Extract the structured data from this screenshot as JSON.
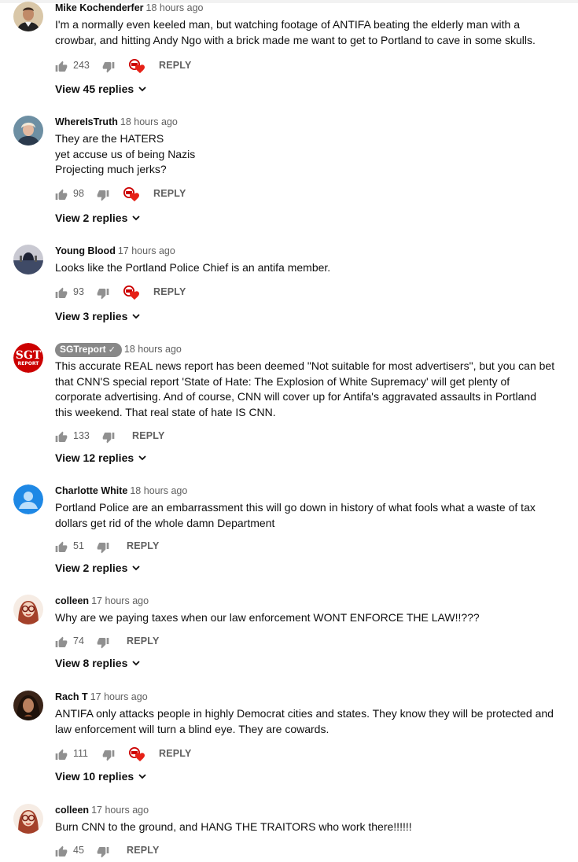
{
  "comments": [
    {
      "author": "Mike Kochenderfer",
      "time": "18 hours ago",
      "lines": [
        "I'm a normally even keeled man, but watching footage of ANTIFA beating the elderly man with a",
        "crowbar, and hitting Andy Ngo with a brick made me want to get to Portland to cave in some skulls."
      ],
      "likes": "243",
      "reply": "REPLY",
      "creator_heart": true,
      "view_replies": "View 45 replies"
    },
    {
      "author": "WhereIsTruth",
      "time": "18 hours ago",
      "lines": [
        "They are the HATERS",
        "yet accuse us of being Nazis",
        "Projecting much jerks?"
      ],
      "likes": "98",
      "reply": "REPLY",
      "creator_heart": true,
      "view_replies": "View 2 replies"
    },
    {
      "author": "Young Blood",
      "time": "17 hours ago",
      "lines": [
        "Looks like the Portland Police Chief is an antifa member."
      ],
      "likes": "93",
      "reply": "REPLY",
      "creator_heart": true,
      "view_replies": "View 3 replies"
    },
    {
      "author": "SGTreport",
      "verified": true,
      "time": "18 hours ago",
      "lines": [
        "This accurate REAL news report has been deemed \"Not suitable for most advertisers\", but you can bet",
        "that CNN'S special report 'State of Hate: The Explosion of White Supremacy' will get plenty of",
        "corporate advertising.  And of course, CNN will cover up for Antifa's aggravated assaults in Portland",
        "this weekend. That real state of hate IS CNN."
      ],
      "likes": "133",
      "reply": "REPLY",
      "creator_heart": false,
      "view_replies": "View 12 replies"
    },
    {
      "author": "Charlotte White",
      "time": "18 hours ago",
      "lines": [
        "Portland Police are an embarrassment this will go down in history of what fools what a waste of tax",
        "dollars get rid of the whole damn Department"
      ],
      "likes": "51",
      "reply": "REPLY",
      "creator_heart": false,
      "view_replies": "View 2 replies"
    },
    {
      "author": "colleen",
      "time": "17 hours ago",
      "lines": [
        "Why are we paying taxes when our law enforcement WONT ENFORCE THE LAW!!???"
      ],
      "likes": "74",
      "reply": "REPLY",
      "creator_heart": false,
      "view_replies": "View 8 replies"
    },
    {
      "author": "Rach T",
      "time": "17 hours ago",
      "lines": [
        "ANTIFA only attacks people in highly Democrat cities and states. They know they will be protected and",
        "law enforcement will turn a blind eye. They are cowards."
      ],
      "likes": "111",
      "reply": "REPLY",
      "creator_heart": true,
      "view_replies": "View 10 replies"
    },
    {
      "author": "colleen",
      "time": "17 hours ago",
      "lines": [
        "Burn CNN to the ground, and HANG THE TRAITORS who work there!!!!!!"
      ],
      "likes": "45",
      "reply": "REPLY",
      "creator_heart": false,
      "view_replies": ""
    }
  ],
  "channel_logo": {
    "line1": "SGT",
    "line2": "REPORT"
  },
  "colors": {
    "text": "#0f0f0f",
    "secondary": "#606060",
    "badge_bg": "#888888",
    "heart": "#e62117",
    "sgt_red": "#cc0000"
  },
  "icons": [
    "thumbs-up-icon",
    "thumbs-down-icon",
    "creator-heart-icon",
    "chevron-down-icon",
    "verified-check-icon"
  ]
}
